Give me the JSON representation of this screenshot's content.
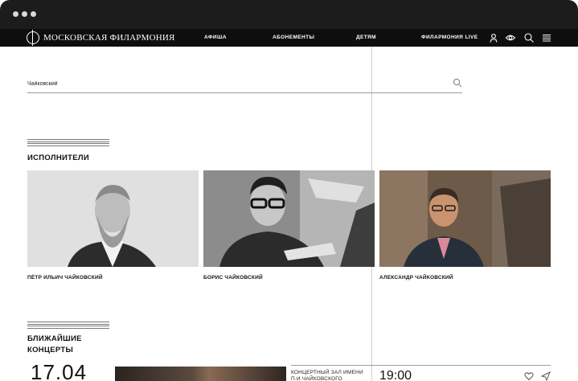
{
  "header": {
    "logo_text": "МОСКОВСКАЯ ФИЛАРМОНИЯ",
    "nav": [
      {
        "label": "АФИША"
      },
      {
        "label": "АБОНЕМЕНТЫ"
      },
      {
        "label": "ДЕТЯМ"
      },
      {
        "label": "ФИЛАРМОНИЯ LIVE"
      }
    ],
    "icons": [
      "user-icon",
      "eye-icon",
      "search-icon",
      "menu-icon"
    ]
  },
  "search": {
    "value": "Чайковский",
    "icon": "search-icon"
  },
  "performers": {
    "title": "ИСПОЛНИТЕЛИ",
    "items": [
      {
        "name": "ПЁТР ИЛЬИЧ ЧАЙКОВСКИЙ"
      },
      {
        "name": "БОРИС ЧАЙКОВСКИЙ"
      },
      {
        "name": "АЛЕКСАНДР ЧАЙКОВСКИЙ"
      }
    ]
  },
  "concerts": {
    "title_line1": "БЛИЖАЙШИЕ",
    "title_line2": "КОНЦЕРТЫ",
    "first": {
      "date": "17.04",
      "venue": "КОНЦЕРТНЫЙ ЗАЛ ИМЕНИ П.И.ЧАЙКОВСКОГО",
      "time": "19:00"
    }
  },
  "colors": {
    "nav_bg": "#0e0e0e",
    "chrome_bg": "#1c1c1c",
    "page_bg": "#ffffff",
    "text": "#111111"
  }
}
